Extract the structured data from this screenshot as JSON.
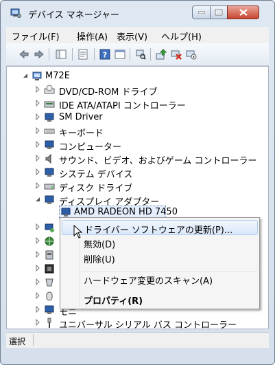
{
  "window": {
    "title": "デバイス マネージャー"
  },
  "menubar": {
    "items": [
      "ファイル(F)",
      "操作(A)",
      "表示(V)",
      "ヘルプ(H)"
    ]
  },
  "toolbar": {
    "icons": [
      "back-icon",
      "forward-icon",
      "show-hide-tree-icon",
      "properties-icon",
      "help-icon",
      "action-view-icon",
      "scan-hardware-icon",
      "update-driver-icon",
      "uninstall-icon",
      "disable-icon"
    ]
  },
  "tree": {
    "root": "M72E",
    "items": [
      "DVD/CD-ROM ドライブ",
      "IDE ATA/ATAPI コントローラー",
      "SM Driver",
      "キーボード",
      "コンピューター",
      "サウンド、ビデオ、およびゲーム コントローラー",
      "システム デバイス",
      "ディスク ドライブ",
      "ディスプレイ アダプター",
      "AMD RADEON HD 7450",
      "ユニバーサル シリアル バス コントローラー"
    ],
    "partial_label": "モニ"
  },
  "context_menu": {
    "update": "ドライバー ソフトウェアの更新(P)...",
    "disable": "無効(D)",
    "delete": "削除(U)",
    "scan": "ハードウェア変更のスキャン(A)",
    "properties": "プロパティ(R)"
  },
  "status": {
    "text": "選択"
  }
}
